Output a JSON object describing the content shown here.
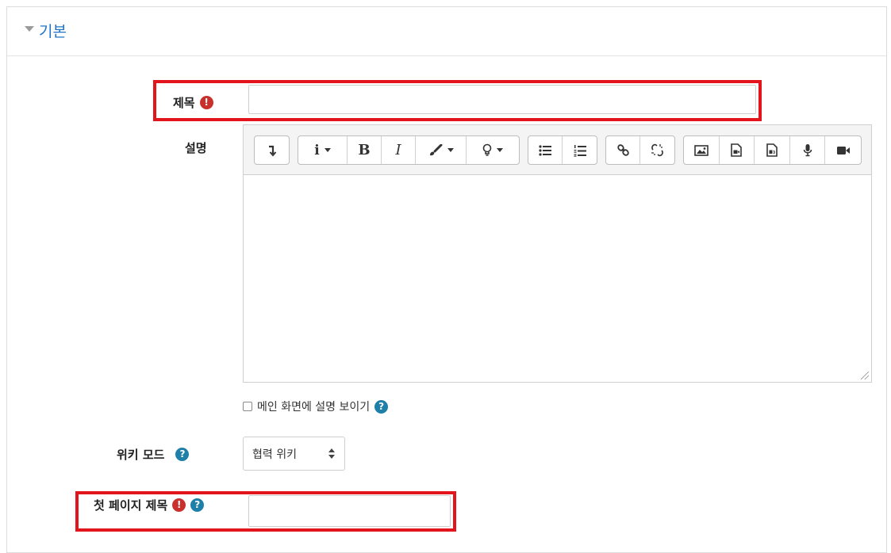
{
  "section": {
    "title": "기본"
  },
  "fields": {
    "name": {
      "label": "제목",
      "value": ""
    },
    "description": {
      "label": "설명"
    },
    "show_description": {
      "label": "메인 화면에 설명 보이기"
    },
    "wiki_mode": {
      "label": "위키 모드",
      "selected": "협력 위키"
    },
    "first_page": {
      "label": "첫 페이지 제목",
      "value": ""
    }
  },
  "icons": {
    "required": "!",
    "help": "?"
  },
  "toolbar": {
    "italic_label": "I",
    "bold_label": "B",
    "info_label": "i"
  },
  "colors": {
    "accent": "#1e73c8",
    "required": "#c9302c",
    "help": "#1e80a8",
    "highlight": "#e2141c"
  }
}
